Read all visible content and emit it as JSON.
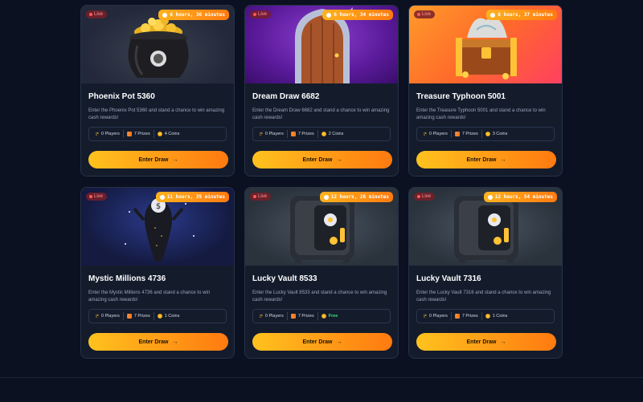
{
  "cards": [
    {
      "live": "Live",
      "timer": "6 hours, 36 minutes",
      "title": "Phoenix Pot 5360",
      "desc": "Enter the Phoenix Pot 5360 and stand a chance to win amazing cash rewards!",
      "players": "0 Players",
      "prizes": "7 Prizes",
      "coins": "4 Coins",
      "button": "Enter Draw",
      "image": "coin-pot"
    },
    {
      "live": "Live",
      "timer": "6 hours, 34 minutes",
      "title": "Dream Draw 6682",
      "desc": "Enter the Dream Draw 6682 and stand a chance to win amazing cash rewards!",
      "players": "0 Players",
      "prizes": "7 Prizes",
      "coins": "2 Coins",
      "button": "Enter Draw",
      "image": "magic-door"
    },
    {
      "live": "Live",
      "timer": "6 hours, 37 minutes",
      "title": "Treasure Typhoon 5001",
      "desc": "Enter the Treasure Typhoon 5001 and stand a chance to win amazing cash rewards!",
      "players": "0 Players",
      "prizes": "7 Prizes",
      "coins": "3 Coins",
      "button": "Enter Draw",
      "image": "treasure-chest"
    },
    {
      "live": "Live",
      "timer": "11 hours, 35 minutes",
      "title": "Mystic Millions 4736",
      "desc": "Enter the Mystic Millions 4736 and stand a chance to win amazing cash rewards!",
      "players": "0 Players",
      "prizes": "7 Prizes",
      "coins": "1 Coins",
      "button": "Enter Draw",
      "image": "money-bag"
    },
    {
      "live": "Live",
      "timer": "12 hours, 26 minutes",
      "title": "Lucky Vault 8533",
      "desc": "Enter the Lucky Vault 8533 and stand a chance to win amazing cash rewards!",
      "players": "0 Players",
      "prizes": "7 Prizes",
      "coins": "Free",
      "button": "Enter Draw",
      "image": "vault-safe"
    },
    {
      "live": "Live",
      "timer": "12 hours, 54 minutes",
      "title": "Lucky Vault 7316",
      "desc": "Enter the Lucky Vault 7316 and stand a chance to win amazing cash rewards!",
      "players": "0 Players",
      "prizes": "7 Prizes",
      "coins": "1 Coins",
      "button": "Enter Draw",
      "image": "vault-safe"
    }
  ],
  "colors": {
    "accent_start": "#ffc21e",
    "accent_end": "#ff7a10",
    "free": "#3ddc84",
    "background": "#0b1120"
  }
}
